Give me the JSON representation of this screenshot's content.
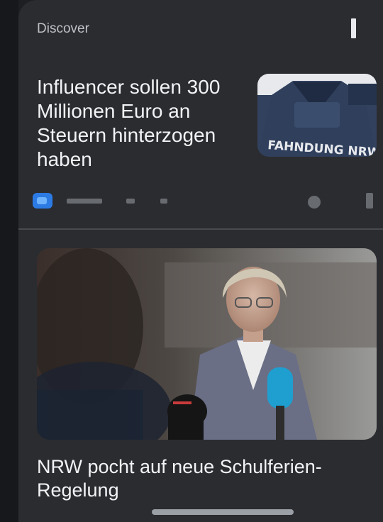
{
  "feed": {
    "label": "Discover"
  },
  "stories": [
    {
      "title": "Influencer sollen 300 Millionen Euro an Steuern hinterzogen haben",
      "thumb_text": "FAHNDUNG NRW"
    },
    {
      "title": "NRW pocht auf neue Schulferien-Regelung"
    }
  ],
  "colors": {
    "background": "#1e1f22",
    "card": "#2b2c30",
    "text": "#e8eaed",
    "source_logo": "#2c7be5"
  }
}
